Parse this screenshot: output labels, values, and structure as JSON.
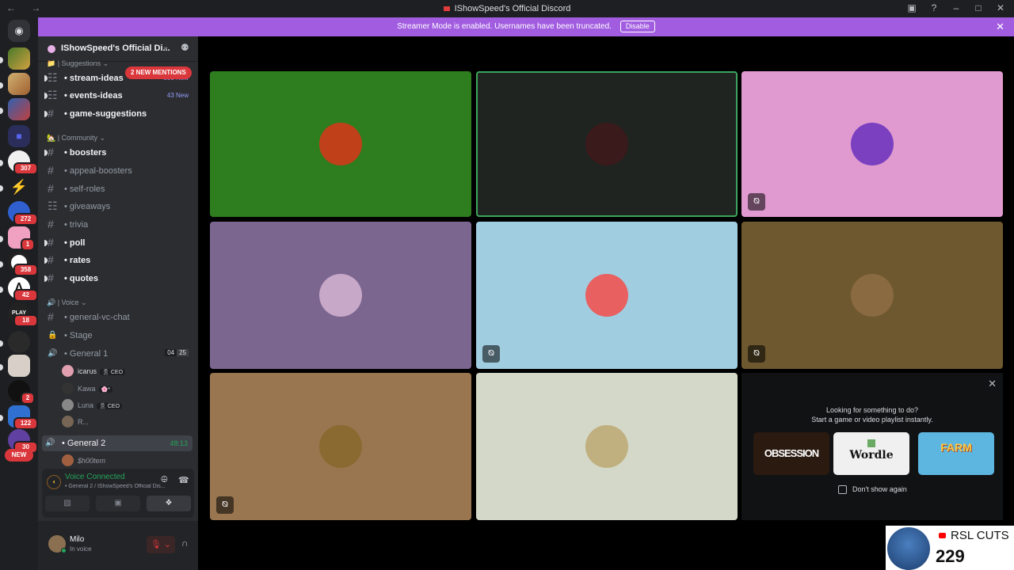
{
  "window": {
    "title": "IShowSpeed's Official Discord",
    "nav": "← →"
  },
  "rail": {
    "servers": [
      {
        "color": "#5c7c3a",
        "y": 0
      },
      {
        "color": "#c0a060"
      },
      {
        "color": "#4070b0"
      },
      {
        "color": "#2a2a6a"
      },
      {
        "color": "#f0f0f0"
      },
      {
        "color": "#23a559"
      },
      {
        "color": "#3060d0"
      },
      {
        "color": "#f0a0c0"
      },
      {
        "color": "#222"
      },
      {
        "color": "#fff"
      },
      {
        "color": "#222"
      },
      {
        "color": "#2a2a2a"
      },
      {
        "color": "#d0c8c0"
      },
      {
        "color": "#1a1a1a"
      },
      {
        "color": "#3070d0"
      },
      {
        "color": "#6040a0"
      }
    ],
    "badges": [
      "307",
      "272",
      "1",
      "358",
      "42",
      "18",
      "2",
      "122",
      "30"
    ],
    "new_label": "NEW"
  },
  "banner": {
    "text": "Streamer Mode is enabled. Usernames have been truncated.",
    "button": "Disable",
    "close": "✕"
  },
  "guild": {
    "name": "IShowSpeed's Official Di...",
    "chevron": "⌄",
    "invite_icon": "⚉"
  },
  "mentions_pill": "2 NEW MENTIONS",
  "categories": {
    "suggestions": "📁 | Suggestions ⌄",
    "community": "🏡 | Community ⌄",
    "voice": "🔊 | Voice ⌄"
  },
  "channels": [
    {
      "icon": "☷",
      "name": "stream-ideas",
      "count": "555 New",
      "unread": true
    },
    {
      "icon": "☷",
      "name": "events-ideas",
      "count": "43 New",
      "unread": true
    },
    {
      "icon": "#",
      "name": "game-suggestions",
      "unread": true
    },
    {
      "icon": "#",
      "name": "boosters",
      "unread": true
    },
    {
      "icon": "#",
      "name": "appeal-boosters",
      "unread": false
    },
    {
      "icon": "#",
      "name": "self-roles",
      "unread": false
    },
    {
      "icon": "☷",
      "name": "giveaways",
      "unread": false
    },
    {
      "icon": "#",
      "name": "trivia",
      "unread": false
    },
    {
      "icon": "#",
      "name": "poll",
      "unread": true
    },
    {
      "icon": "#",
      "name": "rates",
      "unread": true
    },
    {
      "icon": "#",
      "name": "quotes",
      "unread": true
    },
    {
      "icon": "#",
      "name": "general-vc-chat",
      "unread": false
    },
    {
      "icon": "🔒",
      "name": "Stage",
      "unread": false
    },
    {
      "icon": "🔊",
      "name": "General 1",
      "unread": false,
      "boxes": [
        "04",
        "25"
      ]
    },
    {
      "icon": "🔊",
      "name": "General 2",
      "unread": false,
      "timer": "48:13"
    }
  ],
  "voice_users_g1": [
    {
      "name": "icarus",
      "tag": "🎗 CEO",
      "color": "#e0a0b0"
    },
    {
      "name": "Kawa",
      "tag": "🌸*",
      "color": "#333"
    },
    {
      "name": "Luna",
      "tag": "🎗 CEO",
      "color": "#888"
    },
    {
      "name": "R...",
      "tag": "",
      "color": "#776655"
    }
  ],
  "voice_users_g2": [
    {
      "name": "$h00tem",
      "color": "#a06040"
    }
  ],
  "voice_panel": {
    "status": "Voice Connected",
    "location": "General 2 / IShowSpeed's Official Dis...",
    "signal_icon": "◖",
    "noise_icon": "⨸",
    "disconnect_icon": "☎",
    "btn_camera": "▨",
    "btn_screen": "▣",
    "btn_activity": "❖"
  },
  "user": {
    "name": "Milo",
    "state": "In voice",
    "mute_icon": "🎙",
    "headset_icon": "∩",
    "settings_icon": "⚙"
  },
  "tiles": [
    {
      "bg": "#2e7d1f",
      "avatar": "#c0401a",
      "mic_off": false,
      "speaking": false
    },
    {
      "bg": "#1f2421",
      "avatar": "#3a1a1a",
      "mic_off": false,
      "speaking": true
    },
    {
      "bg": "#e09ad0",
      "avatar": "#7a40c0",
      "mic_off": true,
      "speaking": false
    },
    {
      "bg": "#7b6690",
      "avatar": "#c8a8c8",
      "mic_off": false,
      "speaking": false
    },
    {
      "bg": "#a0cde0",
      "avatar": "#e86060",
      "mic_off": true,
      "speaking": false
    },
    {
      "bg": "#6e5830",
      "avatar": "#8a6a40",
      "mic_off": true,
      "speaking": false
    },
    {
      "bg": "#9a7650",
      "avatar": "#8a6a30",
      "mic_off": true,
      "speaking": false
    },
    {
      "bg": "#d4d8c8",
      "avatar": "#c0b080",
      "mic_off": false,
      "speaking": false
    }
  ],
  "activity": {
    "line1": "Looking for something to do?",
    "line2": "Start a game or video playlist instantly.",
    "games": [
      "OBSESSION",
      "Wordle",
      "FARM"
    ],
    "dont_show": "Don't show again",
    "close": "✕"
  },
  "overlay": {
    "name": "RSL CUTS",
    "count": "229"
  }
}
